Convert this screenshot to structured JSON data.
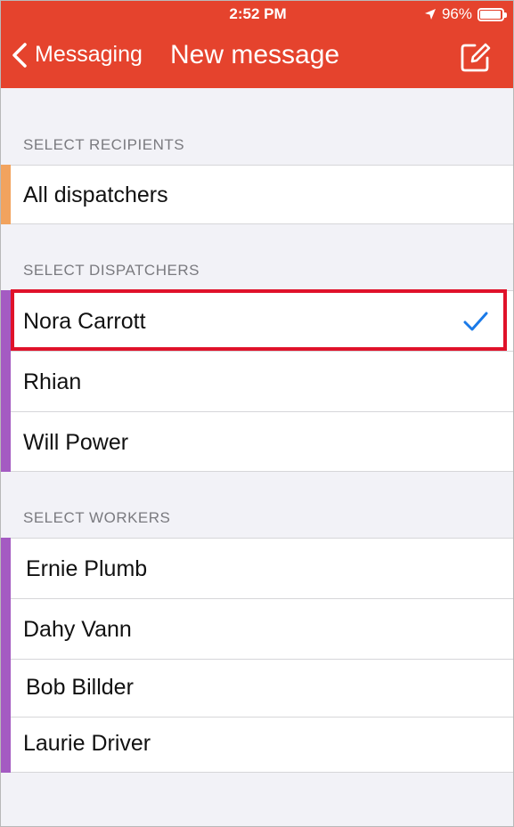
{
  "status_bar": {
    "time": "2:52 PM",
    "battery": "96%",
    "battery_level": 0.96,
    "location_icon": "location-arrow-icon"
  },
  "nav": {
    "back_label": "Messaging",
    "title": "New message",
    "back_icon": "chevron-left-icon",
    "compose_icon": "compose-icon"
  },
  "sections": {
    "recipients": {
      "label": "SELECT RECIPIENTS",
      "items": [
        {
          "name": "All dispatchers",
          "color": "#f2a35e"
        }
      ]
    },
    "dispatchers": {
      "label": "SELECT DISPATCHERS",
      "items": [
        {
          "name": "Nora Carrott",
          "color": "#a45bc2",
          "selected": true
        },
        {
          "name": "Rhian",
          "color": "#a45bc2"
        },
        {
          "name": "Will Power",
          "color": "#a45bc2"
        }
      ]
    },
    "workers": {
      "label": "SELECT WORKERS",
      "items": [
        {
          "name": "Ernie Plumb",
          "color": "#a45bc2"
        },
        {
          "name": "Dahy Vann",
          "color": "#a45bc2"
        },
        {
          "name": "Bob Billder",
          "color": "#a45bc2"
        },
        {
          "name": "Laurie Driver",
          "color": "#a45bc2"
        }
      ]
    }
  },
  "colors": {
    "header": "#e5432d",
    "check": "#1a7ae8",
    "highlight": "#e0122a"
  }
}
